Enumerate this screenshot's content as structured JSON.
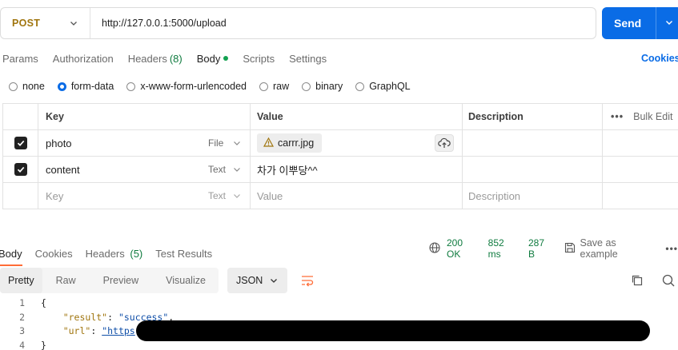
{
  "request": {
    "method": "POST",
    "url": "http://127.0.0.1:5000/upload",
    "send_label": "Send"
  },
  "request_tabs": [
    {
      "label": "Params"
    },
    {
      "label": "Authorization"
    },
    {
      "label": "Headers",
      "count": "(8)"
    },
    {
      "label": "Body",
      "active": true
    },
    {
      "label": "Scripts"
    },
    {
      "label": "Settings"
    }
  ],
  "cookies_label": "Cookies",
  "body_types": [
    {
      "label": "none",
      "checked": false
    },
    {
      "label": "form-data",
      "checked": true
    },
    {
      "label": "x-www-form-urlencoded",
      "checked": false
    },
    {
      "label": "raw",
      "checked": false
    },
    {
      "label": "binary",
      "checked": false
    },
    {
      "label": "GraphQL",
      "checked": false
    }
  ],
  "form_table": {
    "headers": {
      "key": "Key",
      "value": "Value",
      "description": "Description",
      "bulk_edit": "Bulk Edit"
    },
    "rows": [
      {
        "key": "photo",
        "type": "File",
        "value": "carrr.jpg",
        "checked": true
      },
      {
        "key": "content",
        "type": "Text",
        "value": "차가 이뿌당^^",
        "checked": true
      }
    ],
    "empty_row": {
      "key_placeholder": "Key",
      "type": "Text",
      "value_placeholder": "Value",
      "description_placeholder": "Description"
    }
  },
  "response_tabs": [
    {
      "label": "Body",
      "active": true
    },
    {
      "label": "Cookies"
    },
    {
      "label": "Headers",
      "count": "(5)"
    },
    {
      "label": "Test Results"
    }
  ],
  "response_meta": {
    "status": "200 OK",
    "time": "852 ms",
    "size": "287 B",
    "save_label": "Save as example"
  },
  "view_modes": [
    "Pretty",
    "Raw",
    "Preview",
    "Visualize"
  ],
  "format": "JSON",
  "code_lines": {
    "n1": "1",
    "n2": "2",
    "n3": "3",
    "n4": "4",
    "l1": "{",
    "result_key": "\"result\"",
    "result_val": "\"success\"",
    "url_key": "\"url\"",
    "url_val": "\"https",
    "l4": "}"
  },
  "colors": {
    "accent": "#0a6ce6",
    "method": "#a0750e",
    "success": "#0f7b3f",
    "tab_indicator": "#ff6c37"
  }
}
